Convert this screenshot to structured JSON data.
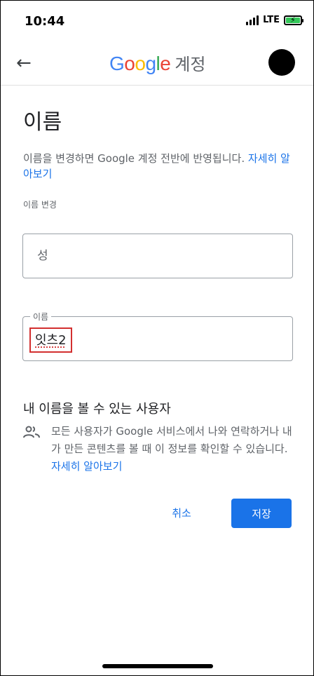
{
  "status_bar": {
    "time": "10:44",
    "network": "LTE"
  },
  "appbar": {
    "brand_letters": [
      "G",
      "o",
      "o",
      "g",
      "l",
      "e"
    ],
    "brand_suffix": "계정"
  },
  "page": {
    "title": "이름",
    "description": "이름을 변경하면 Google 계정 전반에 반영됩니다.",
    "description_link": "자세히 알아보기",
    "section_label": "이름 변경"
  },
  "form": {
    "last_name_placeholder": "성",
    "first_name_label": "이름",
    "first_name_value": "잇츠2"
  },
  "visibility": {
    "title": "내 이름을 볼 수 있는 사용자",
    "text": "모든 사용자가 Google 서비스에서 나와 연락하거나 내가 만든 콘텐츠를 볼 때 이 정보를 확인할 수 있습니다.",
    "link": "자세히 알아보기"
  },
  "actions": {
    "cancel_label": "취소",
    "save_label": "저장"
  },
  "colors": {
    "primary": "#1a73e8",
    "highlight_border": "#d32f2f"
  },
  "icons": {
    "back": "arrow-left-icon",
    "people": "people-icon",
    "battery": "battery-charging-icon",
    "signal": "signal-bars-icon"
  }
}
